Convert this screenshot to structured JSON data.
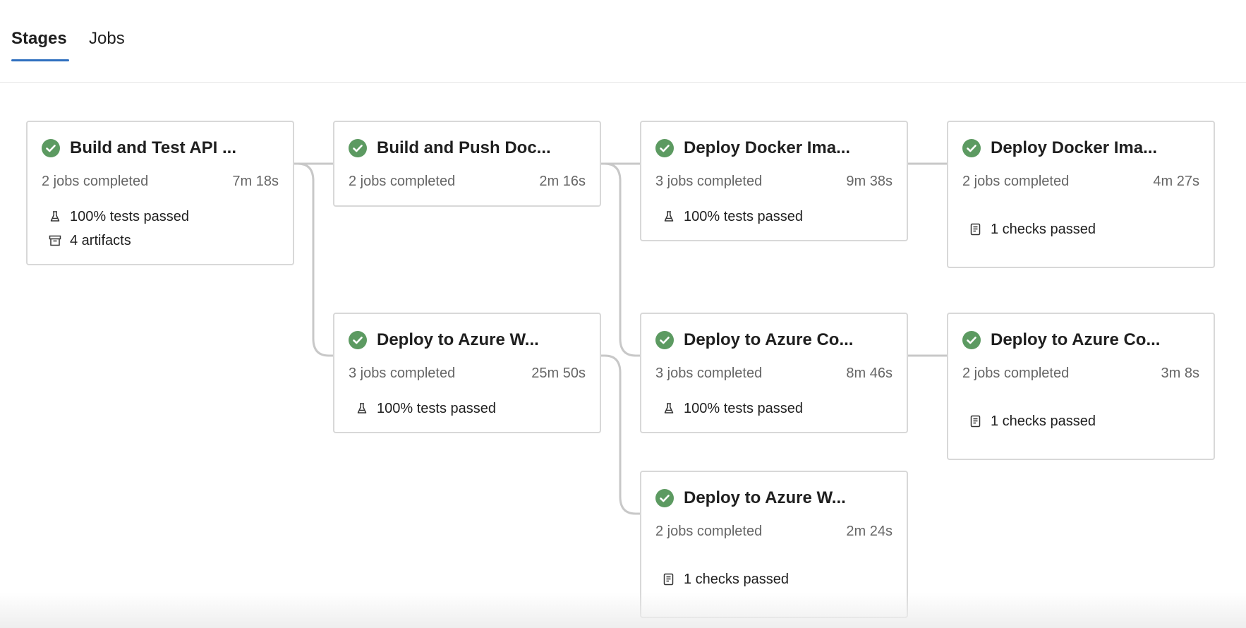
{
  "tabs": {
    "stages": "Stages",
    "jobs": "Jobs"
  },
  "colors": {
    "success": "#5c9a61",
    "tab_accent": "#2f6fbf",
    "connector": "#c8c8c8"
  },
  "stages": {
    "build_test": {
      "title": "Build and Test API ...",
      "jobs": "2 jobs completed",
      "duration": "7m 18s",
      "tests": "100% tests passed",
      "artifacts": "4 artifacts"
    },
    "build_push": {
      "title": "Build and Push Doc...",
      "jobs": "2 jobs completed",
      "duration": "2m 16s"
    },
    "deploy_docker_1": {
      "title": "Deploy Docker Ima...",
      "jobs": "3 jobs completed",
      "duration": "9m 38s",
      "tests": "100% tests passed"
    },
    "deploy_docker_2": {
      "title": "Deploy Docker Ima...",
      "jobs": "2 jobs completed",
      "duration": "4m 27s",
      "checks": "1 checks passed"
    },
    "deploy_azure_w_1": {
      "title": "Deploy to Azure W...",
      "jobs": "3 jobs completed",
      "duration": "25m 50s",
      "tests": "100% tests passed"
    },
    "deploy_azure_co_1": {
      "title": "Deploy to Azure Co...",
      "jobs": "3 jobs completed",
      "duration": "8m 46s",
      "tests": "100% tests passed"
    },
    "deploy_azure_co_2": {
      "title": "Deploy to Azure Co...",
      "jobs": "2 jobs completed",
      "duration": "3m 8s",
      "checks": "1 checks passed"
    },
    "deploy_azure_w_2": {
      "title": "Deploy to Azure W...",
      "jobs": "2 jobs completed",
      "duration": "2m 24s",
      "checks": "1 checks passed"
    }
  },
  "icons": {
    "status": "check-circle-icon",
    "tests": "beaker-icon",
    "artifacts": "archive-box-icon",
    "checks": "checklist-icon"
  }
}
